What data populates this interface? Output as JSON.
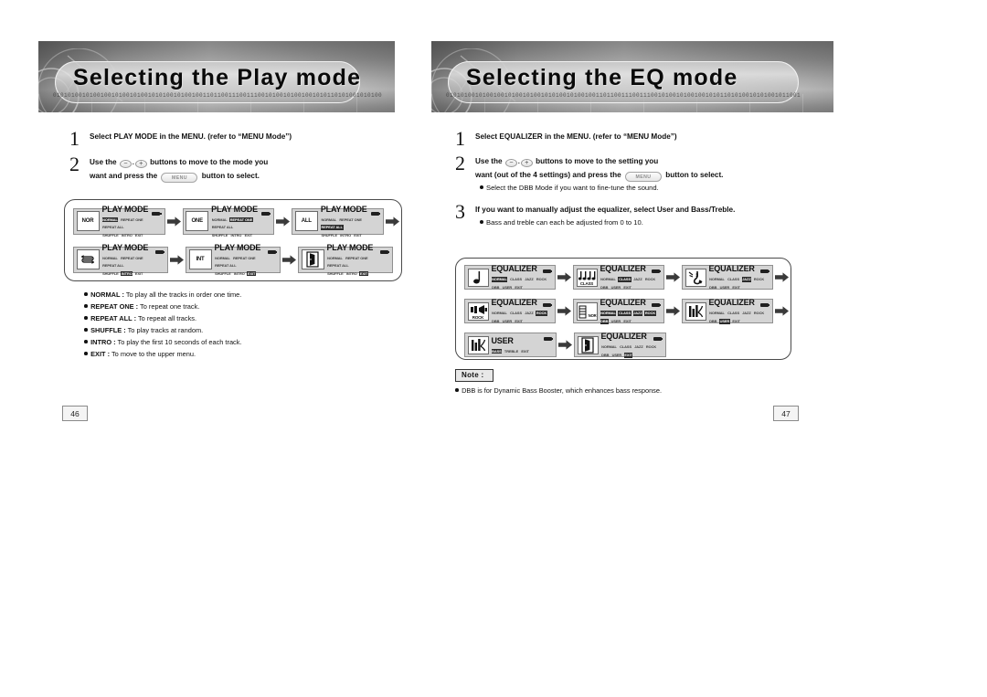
{
  "left_page": {
    "banner_title": "Selecting the Play mode",
    "banner_bits": "0101010010100100101001010010101001010010011011001110011100101001010010010101101010010101001011",
    "steps": [
      {
        "num": "1",
        "line1": "Select PLAY MODE in the MENU. (refer to “MENU Mode”)"
      },
      {
        "num": "2",
        "pre": "Use the",
        "minus": "−",
        "plus": "+",
        "mid": "buttons to move to the mode you",
        "line2_pre": "want and press the",
        "menu_label": "MENU",
        "line2_post": "button to select."
      }
    ],
    "lcd_rows": [
      [
        {
          "icon": "nor-text",
          "icon_label": "NOR",
          "title": "PLAY MODE",
          "options": [
            "NORMAL",
            "REPEAT ONE",
            "REPEAT ALL",
            "SHUFFLE",
            "INTRO",
            "EXIT"
          ],
          "selected": "NORMAL"
        },
        {
          "icon": "one-text",
          "icon_label": "ONE",
          "title": "PLAY MODE",
          "options": [
            "NORMAL",
            "REPEAT ONE",
            "REPEAT ALL",
            "SHUFFLE",
            "INTRO",
            "EXIT"
          ],
          "selected": "REPEAT ONE"
        },
        {
          "icon": "all-text",
          "icon_label": "ALL",
          "title": "PLAY MODE",
          "options": [
            "NORMAL",
            "REPEAT ONE",
            "REPEAT ALL",
            "SHUFFLE",
            "INTRO",
            "EXIT"
          ],
          "selected": "REPEAT ALL"
        }
      ],
      [
        {
          "icon": "shuffle-icon",
          "icon_label": "",
          "title": "PLAY MODE",
          "options": [
            "NORMAL",
            "REPEAT ONE",
            "REPEAT ALL",
            "SHUFFLE",
            "INTRO",
            "EXIT"
          ],
          "selected": "SHUFFLE"
        },
        {
          "icon": "int-text",
          "icon_label": "INT",
          "title": "PLAY MODE",
          "options": [
            "NORMAL",
            "REPEAT ONE",
            "REPEAT ALL",
            "SHUFFLE",
            "INTRO",
            "EXIT"
          ],
          "selected": "INTRO"
        },
        {
          "icon": "exit-door-icon",
          "icon_label": "",
          "title": "PLAY MODE",
          "options": [
            "NORMAL",
            "REPEAT ONE",
            "REPEAT ALL",
            "SHUFFLE",
            "INTRO",
            "EXIT"
          ],
          "selected": "EXIT"
        }
      ]
    ],
    "bullets": [
      {
        "term": "NORMAL :",
        "desc": " To play all the tracks in order one time."
      },
      {
        "term": "REPEAT ONE :",
        "desc": " To repeat one track."
      },
      {
        "term": "REPEAT ALL :",
        "desc": " To repeat all tracks."
      },
      {
        "term": "SHUFFLE :",
        "desc": " To play tracks at random."
      },
      {
        "term": "INTRO :",
        "desc": " To play the first 10 seconds of each track."
      },
      {
        "term": "EXIT :",
        "desc": " To move to the upper menu."
      }
    ],
    "page_number": "46"
  },
  "right_page": {
    "banner_title": "Selecting the EQ mode",
    "banner_bits": "0101010010100100101001010010101001010010011011001110011100101001010010010101101010010101001011001",
    "steps": [
      {
        "num": "1",
        "line1": "Select EQUALIZER in the MENU. (refer to “MENU Mode”)"
      },
      {
        "num": "2",
        "pre": "Use the",
        "minus": "−",
        "plus": "+",
        "mid": "buttons to move to the setting you",
        "line2_pre": "want (out of the 4 settings) and press the",
        "menu_label": "MENU",
        "line2_post": "button to select.",
        "sub": "Select the DBB Mode if you want to fine-tune the sound."
      },
      {
        "num": "3",
        "line1": "If you want to manually adjust the equalizer, select User and Bass/Treble.",
        "sub": "Bass and treble can each be adjusted from 0 to 10."
      }
    ],
    "lcd_rows": [
      [
        {
          "icon": "music-note-icon",
          "icon_label": "",
          "title": "EQUALIZER",
          "options": [
            "NORMAL",
            "CLASS",
            "JAZZ",
            "ROCK",
            "DBB",
            "USER",
            "EXIT"
          ],
          "selected": "NORMAL"
        },
        {
          "icon": "class-icon",
          "icon_label": "CLASS",
          "title": "EQUALIZER",
          "options": [
            "NORMAL",
            "CLASS",
            "JAZZ",
            "ROCK",
            "DBB",
            "USER",
            "EXIT"
          ],
          "selected": "CLASS"
        },
        {
          "icon": "sax-icon",
          "icon_label": "",
          "title": "EQUALIZER",
          "options": [
            "NORMAL",
            "CLASS",
            "JAZZ",
            "ROCK",
            "DBB",
            "USER",
            "EXIT"
          ],
          "selected": "JAZZ"
        }
      ],
      [
        {
          "icon": "rock-icon",
          "icon_label": "ROCK",
          "title": "EQUALIZER",
          "options": [
            "NORMAL",
            "CLASS",
            "JAZZ",
            "ROCK",
            "DBB",
            "USER",
            "EXIT"
          ],
          "selected": "ROCK"
        },
        {
          "icon": "dbb-icon",
          "icon_label": "NOR",
          "title": "EQUALIZER",
          "options": [
            "NORMAL",
            "CLASS",
            "JAZZ",
            "ROCK",
            "DBB",
            "USER",
            "EXIT"
          ],
          "selected": "DBB"
        },
        {
          "icon": "equalizer-bars-icon",
          "icon_label": "",
          "title": "EQUALIZER",
          "options": [
            "NORMAL",
            "CLASS",
            "JAZZ",
            "ROCK",
            "DBB",
            "USER",
            "EXIT"
          ],
          "selected": "USER"
        }
      ],
      [
        {
          "icon": "equalizer-bars-icon",
          "icon_label": "",
          "title": "USER",
          "options": [
            "BASS",
            "TREBLE",
            "EXIT"
          ],
          "selected": "BASS"
        },
        {
          "icon": "exit-door-icon",
          "icon_label": "",
          "title": "EQUALIZER",
          "options": [
            "NORMAL",
            "CLASS",
            "JAZZ",
            "ROCK",
            "DBB",
            "USER",
            "EXIT"
          ],
          "selected": "EXIT"
        }
      ]
    ],
    "note": {
      "label": "Note :",
      "text": "DBB is for Dynamic Bass Booster, which enhances bass response."
    },
    "page_number": "47"
  }
}
